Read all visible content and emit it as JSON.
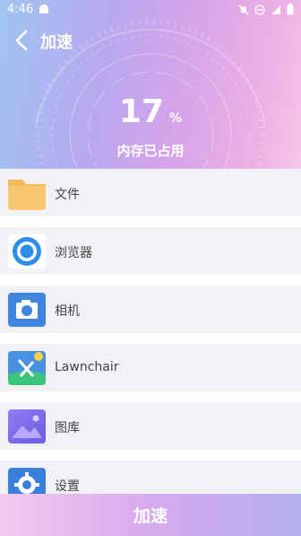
{
  "status": {
    "time": "4:46"
  },
  "header": {
    "title": "加速"
  },
  "memory": {
    "percent": "17",
    "unit": "%",
    "label": "内存已占用"
  },
  "apps": [
    {
      "name": "文件",
      "icon": "folder-icon"
    },
    {
      "name": "浏览器",
      "icon": "browser-icon"
    },
    {
      "name": "相机",
      "icon": "camera-icon"
    },
    {
      "name": "Lawnchair",
      "icon": "lawnchair-icon"
    },
    {
      "name": "图库",
      "icon": "gallery-icon"
    },
    {
      "name": "设置",
      "icon": "settings-icon"
    }
  ],
  "action": {
    "label": "加速"
  },
  "colors": {
    "accent_start": "#9fc4f2",
    "accent_end": "#f6c6e8",
    "list_bg": "#f0f2f5"
  }
}
